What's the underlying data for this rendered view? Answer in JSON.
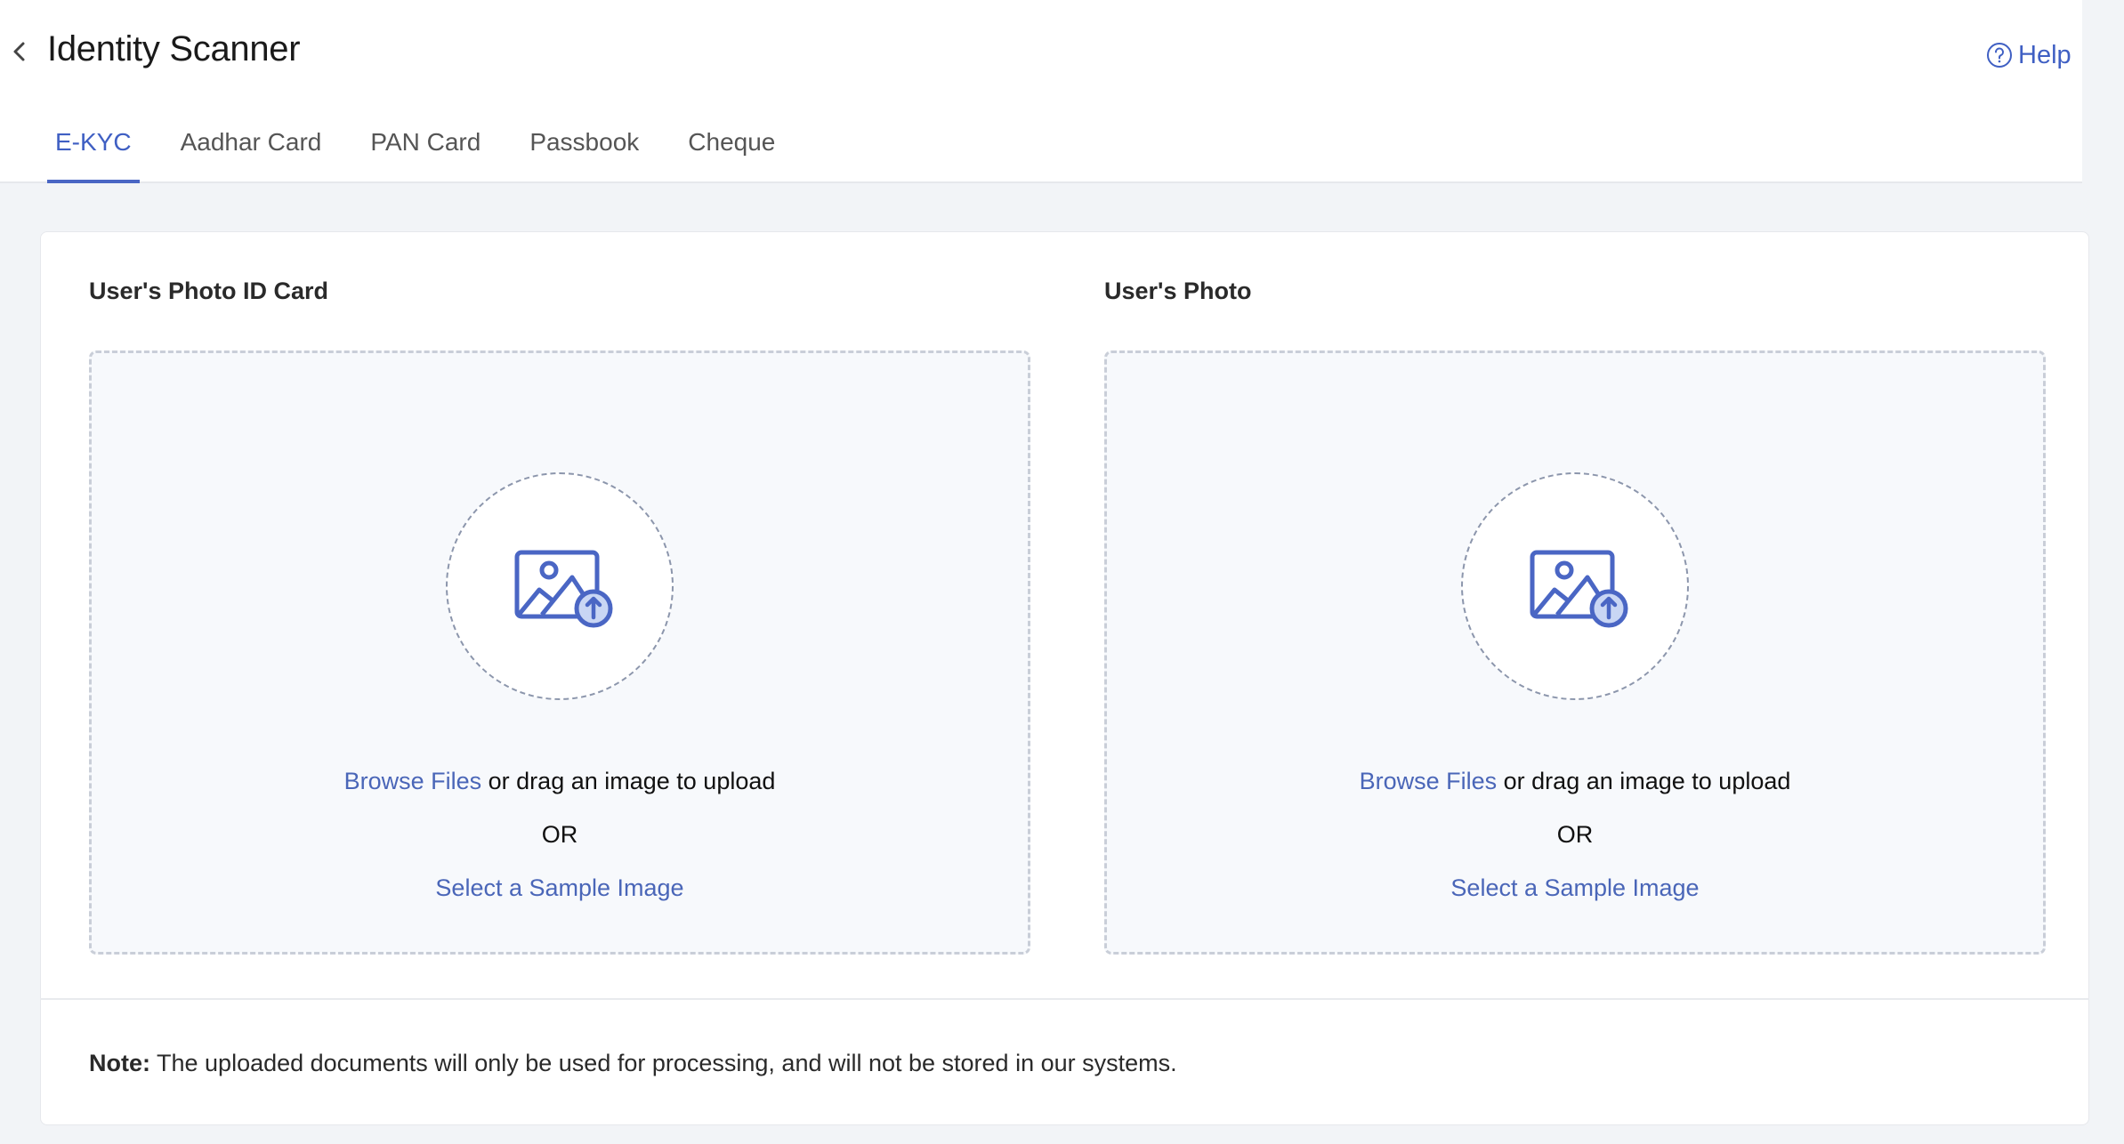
{
  "header": {
    "title": "Identity Scanner",
    "back_label": "Back",
    "help_label": "Help"
  },
  "tabs": [
    {
      "label": "E-KYC",
      "active": true
    },
    {
      "label": "Aadhar Card",
      "active": false
    },
    {
      "label": "PAN Card",
      "active": false
    },
    {
      "label": "Passbook",
      "active": false
    },
    {
      "label": "Cheque",
      "active": false
    }
  ],
  "upload_sections": [
    {
      "title": "User's Photo ID Card",
      "browse_label": "Browse Files",
      "drag_text": " or drag an image to upload",
      "or_text": "OR",
      "sample_label": "Select a Sample Image",
      "icon": "image-upload-icon"
    },
    {
      "title": "User's Photo",
      "browse_label": "Browse Files",
      "drag_text": " or drag an image to upload",
      "or_text": "OR",
      "sample_label": "Select a Sample Image",
      "icon": "image-upload-icon"
    }
  ],
  "note": {
    "label": "Note:",
    "text": " The uploaded documents will only be used for processing, and will not be stored in our systems."
  },
  "colors": {
    "accent": "#4a66c4",
    "link": "#4a66b8",
    "page_bg": "#f2f4f7",
    "dropzone_bg": "#f7f9fc"
  }
}
